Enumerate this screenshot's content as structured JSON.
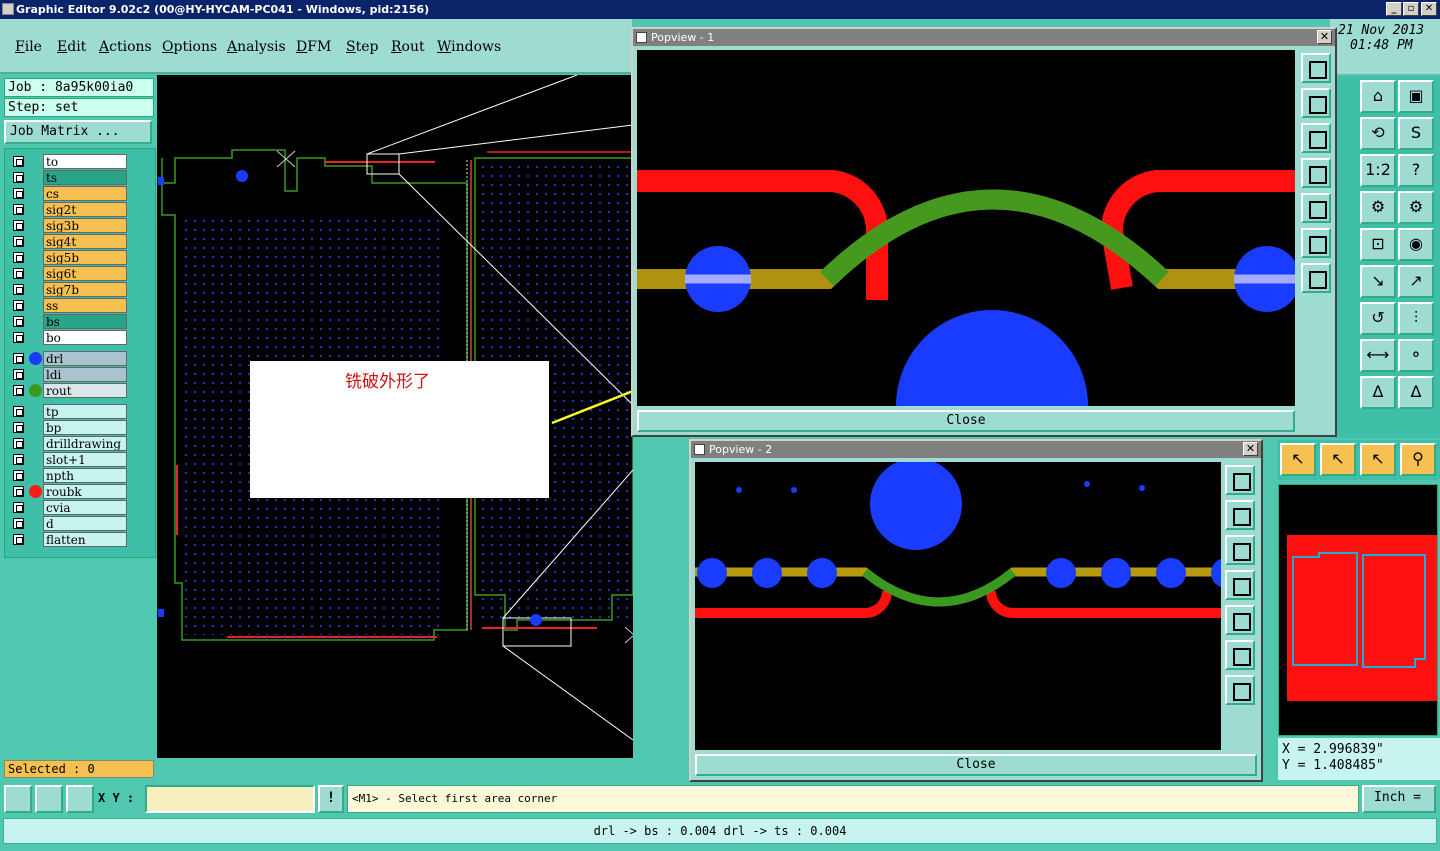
{
  "window": {
    "title": "Graphic Editor 9.02c2 (00@HY-HYCAM-PC041 - Windows, pid:2156)",
    "min_label": "_",
    "restore_label": "▫",
    "close_label": "✕"
  },
  "menu": [
    "File",
    "Edit",
    "Actions",
    "Options",
    "Analysis",
    "DFM",
    "Step",
    "Rout",
    "Windows"
  ],
  "datetime": {
    "date": "21 Nov 2013",
    "time": "01:48 PM"
  },
  "job": {
    "job_label": "Job : 8a95k00ia0",
    "step_label": "Step: set",
    "matrix_label": "Job Matrix ..."
  },
  "layers_group1": [
    {
      "name": "to",
      "color": "#ffffff"
    },
    {
      "name": "ts",
      "color": "#2aa488"
    },
    {
      "name": "cs",
      "color": "#f5c050"
    },
    {
      "name": "sig2t",
      "color": "#f5c050"
    },
    {
      "name": "sig3b",
      "color": "#f5c050"
    },
    {
      "name": "sig4t",
      "color": "#f5c050"
    },
    {
      "name": "sig5b",
      "color": "#f5c050"
    },
    {
      "name": "sig6t",
      "color": "#f5c050"
    },
    {
      "name": "sig7b",
      "color": "#f5c050"
    },
    {
      "name": "ss",
      "color": "#f5c050"
    },
    {
      "name": "bs",
      "color": "#2aa488"
    },
    {
      "name": "bo",
      "color": "#ffffff"
    }
  ],
  "layers_group2": [
    {
      "name": "drl",
      "color": "#a8c4d0",
      "dot": "#1a3cff"
    },
    {
      "name": "ldi",
      "color": "#a8c4d0",
      "dot": ""
    },
    {
      "name": "rout",
      "color": "#d8e8e8",
      "dot": "#3a9a20"
    }
  ],
  "layers_group3": [
    {
      "name": "tp",
      "dot": ""
    },
    {
      "name": "bp",
      "dot": ""
    },
    {
      "name": "drilldrawing",
      "dot": ""
    },
    {
      "name": "slot+1",
      "dot": ""
    },
    {
      "name": "npth",
      "dot": ""
    },
    {
      "name": "roubk",
      "dot": "#ff1a1a"
    },
    {
      "name": "cvia",
      "dot": ""
    },
    {
      "name": "d",
      "dot": ""
    },
    {
      "name": "flatten",
      "dot": ""
    }
  ],
  "selected_label": "Selected : 0",
  "annotation_text": "铣破外形了",
  "popview1": {
    "title": "Popview - 1",
    "close_label": "Close"
  },
  "popview2": {
    "title": "Popview - 2",
    "close_label": "Close"
  },
  "right_tools": [
    "⌂",
    "▣",
    "⟲",
    "S",
    "1:2",
    "?",
    "⚙",
    "⚙",
    "⊡",
    "◉",
    "↘",
    "↗",
    "↺",
    "⫶",
    "⟷",
    "⚬",
    "Δ",
    "Δ"
  ],
  "cursor_tools": [
    "↖",
    "↖",
    "↖",
    "⚲"
  ],
  "coords": {
    "x": "X = 2.996839\"",
    "y": "Y = 1.408485\""
  },
  "bottom": {
    "xy_label": "X Y :",
    "xy_value": "",
    "excl_label": "!",
    "prompt": "<M1> - Select first area corner",
    "unit_label": "Inch ="
  },
  "status_text": "drl -> bs : 0.004   drl -> ts : 0.004"
}
